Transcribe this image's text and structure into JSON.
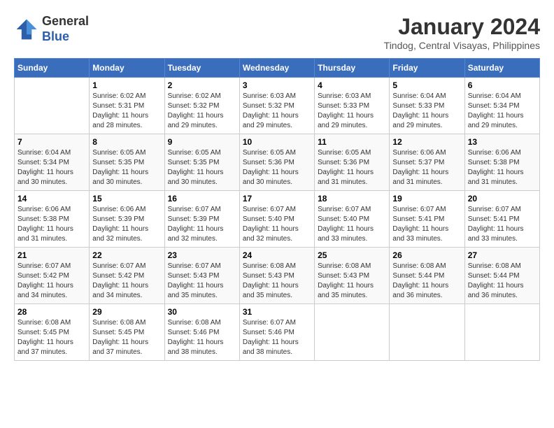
{
  "header": {
    "logo_line1": "General",
    "logo_line2": "Blue",
    "month": "January 2024",
    "location": "Tindog, Central Visayas, Philippines"
  },
  "days_of_week": [
    "Sunday",
    "Monday",
    "Tuesday",
    "Wednesday",
    "Thursday",
    "Friday",
    "Saturday"
  ],
  "weeks": [
    [
      {
        "day": "",
        "sunrise": "",
        "sunset": "",
        "daylight": ""
      },
      {
        "day": "1",
        "sunrise": "6:02 AM",
        "sunset": "5:31 PM",
        "daylight": "11 hours and 28 minutes."
      },
      {
        "day": "2",
        "sunrise": "6:02 AM",
        "sunset": "5:32 PM",
        "daylight": "11 hours and 29 minutes."
      },
      {
        "day": "3",
        "sunrise": "6:03 AM",
        "sunset": "5:32 PM",
        "daylight": "11 hours and 29 minutes."
      },
      {
        "day": "4",
        "sunrise": "6:03 AM",
        "sunset": "5:33 PM",
        "daylight": "11 hours and 29 minutes."
      },
      {
        "day": "5",
        "sunrise": "6:04 AM",
        "sunset": "5:33 PM",
        "daylight": "11 hours and 29 minutes."
      },
      {
        "day": "6",
        "sunrise": "6:04 AM",
        "sunset": "5:34 PM",
        "daylight": "11 hours and 29 minutes."
      }
    ],
    [
      {
        "day": "7",
        "sunrise": "6:04 AM",
        "sunset": "5:34 PM",
        "daylight": "11 hours and 30 minutes."
      },
      {
        "day": "8",
        "sunrise": "6:05 AM",
        "sunset": "5:35 PM",
        "daylight": "11 hours and 30 minutes."
      },
      {
        "day": "9",
        "sunrise": "6:05 AM",
        "sunset": "5:35 PM",
        "daylight": "11 hours and 30 minutes."
      },
      {
        "day": "10",
        "sunrise": "6:05 AM",
        "sunset": "5:36 PM",
        "daylight": "11 hours and 30 minutes."
      },
      {
        "day": "11",
        "sunrise": "6:05 AM",
        "sunset": "5:36 PM",
        "daylight": "11 hours and 31 minutes."
      },
      {
        "day": "12",
        "sunrise": "6:06 AM",
        "sunset": "5:37 PM",
        "daylight": "11 hours and 31 minutes."
      },
      {
        "day": "13",
        "sunrise": "6:06 AM",
        "sunset": "5:38 PM",
        "daylight": "11 hours and 31 minutes."
      }
    ],
    [
      {
        "day": "14",
        "sunrise": "6:06 AM",
        "sunset": "5:38 PM",
        "daylight": "11 hours and 31 minutes."
      },
      {
        "day": "15",
        "sunrise": "6:06 AM",
        "sunset": "5:39 PM",
        "daylight": "11 hours and 32 minutes."
      },
      {
        "day": "16",
        "sunrise": "6:07 AM",
        "sunset": "5:39 PM",
        "daylight": "11 hours and 32 minutes."
      },
      {
        "day": "17",
        "sunrise": "6:07 AM",
        "sunset": "5:40 PM",
        "daylight": "11 hours and 32 minutes."
      },
      {
        "day": "18",
        "sunrise": "6:07 AM",
        "sunset": "5:40 PM",
        "daylight": "11 hours and 33 minutes."
      },
      {
        "day": "19",
        "sunrise": "6:07 AM",
        "sunset": "5:41 PM",
        "daylight": "11 hours and 33 minutes."
      },
      {
        "day": "20",
        "sunrise": "6:07 AM",
        "sunset": "5:41 PM",
        "daylight": "11 hours and 33 minutes."
      }
    ],
    [
      {
        "day": "21",
        "sunrise": "6:07 AM",
        "sunset": "5:42 PM",
        "daylight": "11 hours and 34 minutes."
      },
      {
        "day": "22",
        "sunrise": "6:07 AM",
        "sunset": "5:42 PM",
        "daylight": "11 hours and 34 minutes."
      },
      {
        "day": "23",
        "sunrise": "6:07 AM",
        "sunset": "5:43 PM",
        "daylight": "11 hours and 35 minutes."
      },
      {
        "day": "24",
        "sunrise": "6:08 AM",
        "sunset": "5:43 PM",
        "daylight": "11 hours and 35 minutes."
      },
      {
        "day": "25",
        "sunrise": "6:08 AM",
        "sunset": "5:43 PM",
        "daylight": "11 hours and 35 minutes."
      },
      {
        "day": "26",
        "sunrise": "6:08 AM",
        "sunset": "5:44 PM",
        "daylight": "11 hours and 36 minutes."
      },
      {
        "day": "27",
        "sunrise": "6:08 AM",
        "sunset": "5:44 PM",
        "daylight": "11 hours and 36 minutes."
      }
    ],
    [
      {
        "day": "28",
        "sunrise": "6:08 AM",
        "sunset": "5:45 PM",
        "daylight": "11 hours and 37 minutes."
      },
      {
        "day": "29",
        "sunrise": "6:08 AM",
        "sunset": "5:45 PM",
        "daylight": "11 hours and 37 minutes."
      },
      {
        "day": "30",
        "sunrise": "6:08 AM",
        "sunset": "5:46 PM",
        "daylight": "11 hours and 38 minutes."
      },
      {
        "day": "31",
        "sunrise": "6:07 AM",
        "sunset": "5:46 PM",
        "daylight": "11 hours and 38 minutes."
      },
      {
        "day": "",
        "sunrise": "",
        "sunset": "",
        "daylight": ""
      },
      {
        "day": "",
        "sunrise": "",
        "sunset": "",
        "daylight": ""
      },
      {
        "day": "",
        "sunrise": "",
        "sunset": "",
        "daylight": ""
      }
    ]
  ]
}
